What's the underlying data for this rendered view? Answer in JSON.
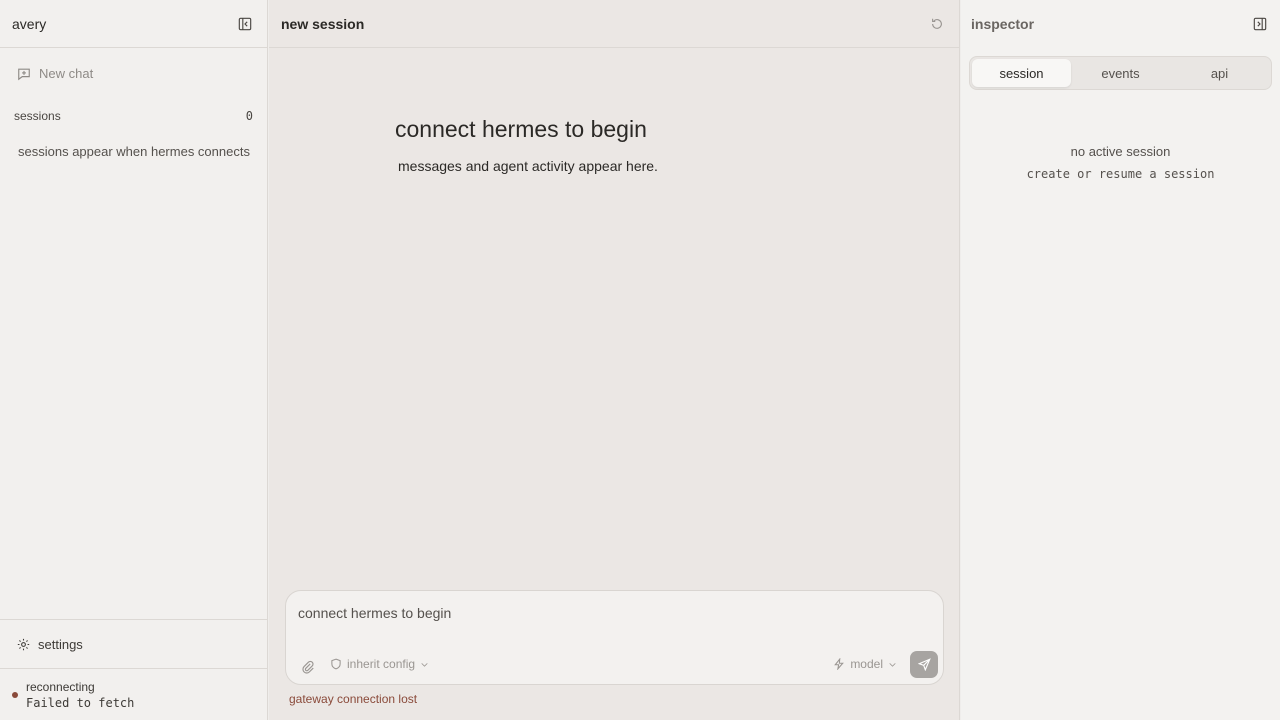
{
  "sidebar": {
    "title": "avery",
    "new_chat": "New chat",
    "sessions_label": "sessions",
    "sessions_count": "0",
    "sessions_empty": "sessions appear when hermes connects",
    "settings_label": "settings",
    "status_title": "reconnecting",
    "status_detail": "Failed to fetch"
  },
  "main": {
    "title": "new session",
    "empty_title": "connect hermes to begin",
    "empty_subtitle": "messages and agent activity appear here.",
    "composer": {
      "placeholder": "connect hermes to begin",
      "config_label": "inherit config",
      "model_label": "model"
    },
    "connection_warning": "gateway connection lost"
  },
  "inspector": {
    "title": "inspector",
    "tabs": [
      {
        "label": "session",
        "active": true
      },
      {
        "label": "events",
        "active": false
      },
      {
        "label": "api",
        "active": false
      }
    ],
    "empty_title": "no active session",
    "empty_subtitle": "create or resume a session"
  },
  "colors": {
    "error": "#8a4a3a",
    "send_disabled": "#a7a4a1"
  }
}
